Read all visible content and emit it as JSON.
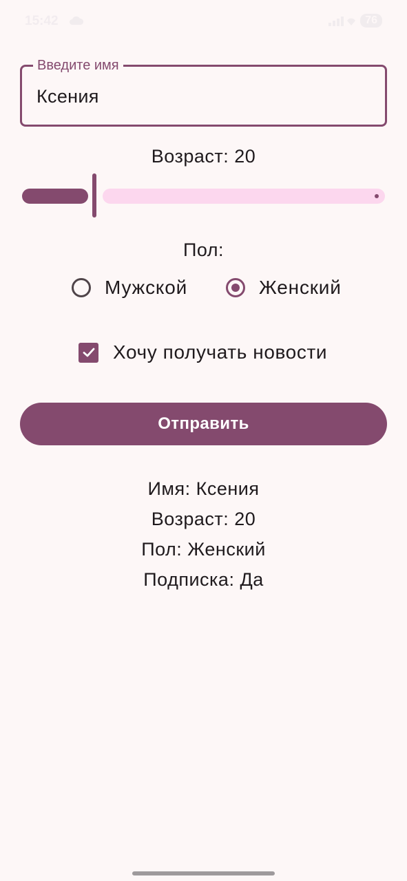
{
  "status_bar": {
    "time": "15:42",
    "battery": "76"
  },
  "form": {
    "name_field": {
      "label": "Введите имя",
      "value": "Ксения"
    },
    "age": {
      "label": "Возраст: 20",
      "slider_fraction": 0.2
    },
    "gender": {
      "title": "Пол:",
      "options": [
        {
          "label": "Мужской",
          "selected": false
        },
        {
          "label": "Женский",
          "selected": true
        }
      ]
    },
    "subscribe": {
      "label": "Хочу получать новости",
      "checked": true
    },
    "submit_label": "Отправить"
  },
  "result": {
    "name": "Имя: Ксения",
    "age": "Возраст: 20",
    "gender": "Пол: Женский",
    "subscription": "Подписка: Да"
  },
  "colors": {
    "primary": "#844A6E",
    "slider_inactive": "#FCD7EE",
    "background": "#FDF7F7",
    "text": "#1F1A1D"
  }
}
